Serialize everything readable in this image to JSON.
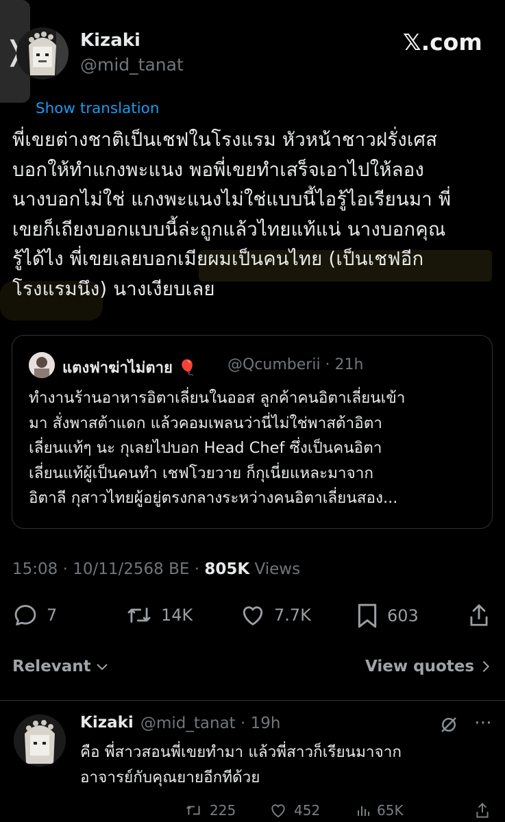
{
  "site": "𝕏.com",
  "tweet": {
    "author_name": "Kizaki",
    "author_handle": "@mid_tanat",
    "show_translation": "Show translation",
    "lines": [
      "พี่เขยต่างชาติเป็นเชฟในโรงแรม หัวหน้าชาวฝรั่งเศส",
      "บอกให้ทำแกงพะแนง พอพี่เขยทำเสร็จเอาไปให้ลอง",
      "นางบอกไม่ใช่ แกงพะแนงไม่ใช่แบบนี้ไอรู้ไอเรียนมา พี่",
      "เขยก็เถียงบอกแบบนี้ล่ะถูกแล้วไทยแท้แน่ นางบอกคุณ",
      "รู้ได้ไง พี่เขยเลยบอกเมียผมเป็นคนไทย (เป็นเชฟอีก",
      "โรงแรมนึง) นางเงียบเลย"
    ],
    "timestamp": "15:08 · 10/11/2568 BE · ",
    "views_count": "805K",
    "views_label": " Views",
    "stats": {
      "replies": "7",
      "reposts": "14K",
      "likes": "7.7K",
      "bookmarks": "603"
    }
  },
  "quote": {
    "author_name": "แตงฟาฆ่าไม่ตาย 🎈",
    "handle_time": "@Qcumberii · 21h",
    "lines": [
      "ทำงานร้านอาหารอิตาเลี่ยนในออส ลูกค้าคนอิตาเลี่ยนเข้า",
      "มา สั่งพาสต้าแดก แล้วคอมเพลนว่านี่ไม่ใช่พาสต้าอิตา",
      "เลี่ยนแท้ๆ นะ กุเลยไปบอก Head Chef ซึ่งเป็นคนอิตา",
      "เลี่ยนแท้ผู้เป็นคนทำ เชฟโวยวาย ก็กุเนี่ยแหละมาจาก",
      "อิตาลี กุสาวไทยผู้อยู่ตรงกลางระหว่างคนอิตาเลี่ยนสอง..."
    ]
  },
  "filter": {
    "relevant_label": "Relevant",
    "view_quotes_label": "View quotes"
  },
  "reply": {
    "author_name": "Kizaki",
    "handle_time": "@mid_tanat · 19h",
    "lines": [
      "คือ พี่สาวสอนพี่เขยทำมา แล้วพี่สาวก็เรียนมาจาก",
      "อาจารย์กับคุณยายอีกทีด้วย"
    ],
    "stats": {
      "reposts": "225",
      "likes": "452",
      "views": "65K"
    }
  },
  "colors": {
    "background": "#000000",
    "text": "#e7e9ea",
    "secondary": "#71767b",
    "link": "#1d9bf0",
    "highlight": "#f5dc5a"
  }
}
